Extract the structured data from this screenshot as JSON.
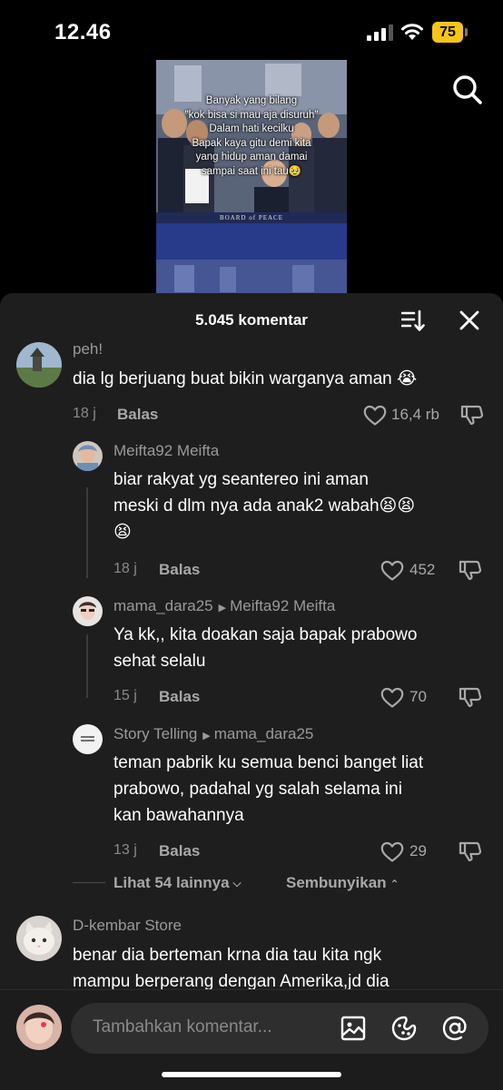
{
  "status_bar": {
    "time": "12.46",
    "battery": "75"
  },
  "video": {
    "caption": [
      "Banyak yang bilang",
      "\"kok bisa si mau aja disuruh\"",
      "Dalam hati kecilku",
      "Bapak kaya gitu demi kita",
      "yang hidup aman damai",
      "sampai saat ini tau🥹"
    ],
    "banner": "BOARD of PEACE"
  },
  "sheet": {
    "comment_count": "5.045 komentar"
  },
  "comments": [
    {
      "username": "peh!",
      "lines": [
        "dia lg berjuang buat bikin warganya aman 😭"
      ],
      "time": "18 j",
      "reply": "Balas",
      "likes": "16,4 rb"
    },
    {
      "username": "Meifta92 Meifta",
      "lines": [
        "biar rakyat yg seantereo ini aman",
        "meski d dlm nya ada anak2 wabah😫😫",
        "😫"
      ],
      "time": "18 j",
      "reply": "Balas",
      "likes": "452"
    },
    {
      "username": "mama_dara25",
      "reply_to": "Meifta92 Meifta",
      "lines": [
        "Ya kk,, kita doakan saja bapak prabowo",
        "sehat selalu"
      ],
      "time": "15 j",
      "reply": "Balas",
      "likes": "70"
    },
    {
      "username": "Story Telling",
      "reply_to": "mama_dara25",
      "lines": [
        "teman pabrik ku semua benci banget liat",
        "prabowo, padahal yg salah selama ini",
        "kan bawahannya"
      ],
      "time": "13 j",
      "reply": "Balas",
      "likes": "29"
    },
    {
      "username": "D-kembar Store",
      "lines": [
        "benar dia berteman krna dia tau kita ngk",
        "mampu berperang dengan Amerika,jd dia"
      ]
    }
  ],
  "thread": {
    "view_more": "Lihat 54 lainnya",
    "hide": "Sembunyikan"
  },
  "composer": {
    "placeholder": "Tambahkan komentar..."
  },
  "colors": {
    "sheet_bg": "#1e1e1e",
    "battery": "#f5c518",
    "text_secondary": "#9a9a9a"
  }
}
